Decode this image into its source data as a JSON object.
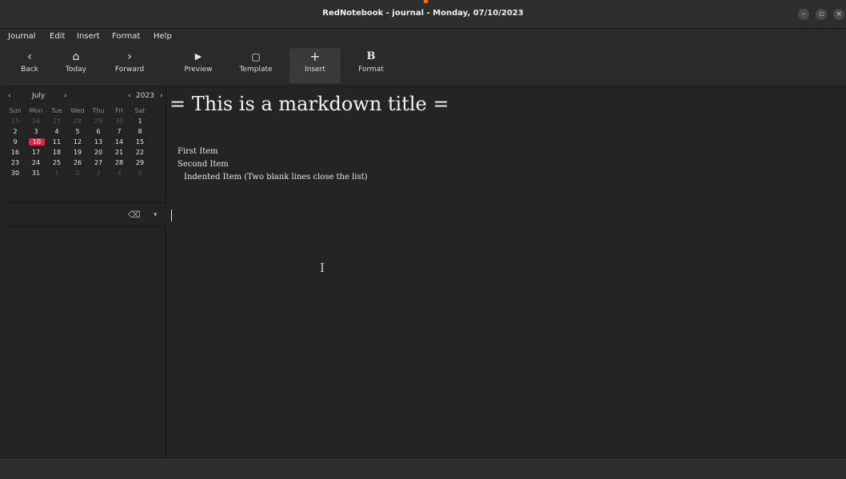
{
  "window": {
    "title": "RedNotebook - journal - Monday, 07/10/2023",
    "controls": [
      "minimize-icon",
      "maximize-icon",
      "close-icon"
    ]
  },
  "menu": {
    "items": [
      "Journal",
      "Edit",
      "Insert",
      "Format",
      "Help"
    ]
  },
  "toolbar": {
    "back": {
      "label": "Back",
      "icon": "chevron-left-icon"
    },
    "today": {
      "label": "Today",
      "icon": "home-icon"
    },
    "forward": {
      "label": "Forward",
      "icon": "chevron-right-icon"
    },
    "preview": {
      "label": "Preview",
      "icon": "play-icon"
    },
    "template": {
      "label": "Template",
      "icon": "clipboard-icon"
    },
    "insert": {
      "label": "Insert",
      "icon": "plus-icon"
    },
    "format": {
      "label": "Format",
      "icon": "bold-icon"
    }
  },
  "calendar": {
    "month": "July",
    "year": "2023",
    "weekdays": [
      "Sun",
      "Mon",
      "Tue",
      "Wed",
      "Thu",
      "Fri",
      "Sat"
    ],
    "weeks": [
      [
        "25",
        "26",
        "27",
        "28",
        "29",
        "30",
        "1"
      ],
      [
        "2",
        "3",
        "4",
        "5",
        "6",
        "7",
        "8"
      ],
      [
        "9",
        "10",
        "11",
        "12",
        "13",
        "14",
        "15"
      ],
      [
        "16",
        "17",
        "18",
        "19",
        "20",
        "21",
        "22"
      ],
      [
        "23",
        "24",
        "25",
        "26",
        "27",
        "28",
        "29"
      ],
      [
        "30",
        "31",
        "1",
        "2",
        "3",
        "4",
        "5"
      ]
    ],
    "selected_day": "10",
    "highlight_color": "#e0294a"
  },
  "search": {
    "value": ""
  },
  "editor": {
    "title_line": "= This is a markdown title =",
    "lines": [
      "First Item",
      "Second Item",
      "Indented Item (Two blank lines close the list)"
    ]
  }
}
